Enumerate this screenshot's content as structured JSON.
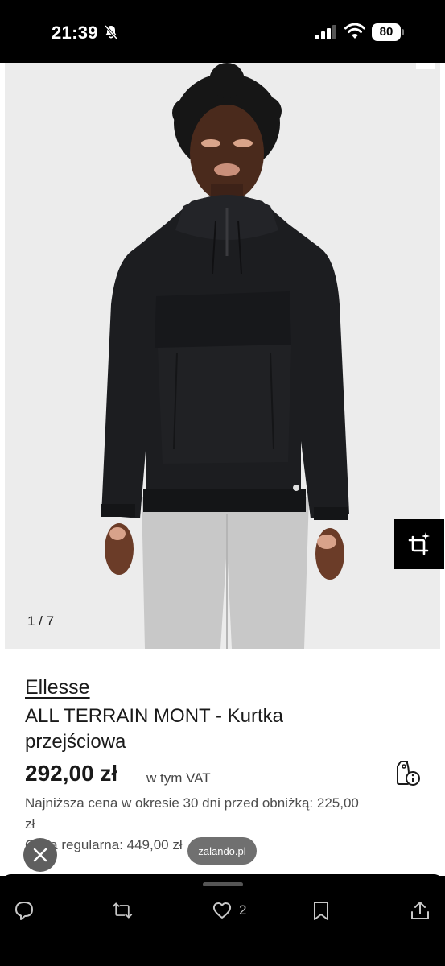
{
  "status_bar": {
    "time": "21:39",
    "battery": "80"
  },
  "gallery": {
    "counter": "1 / 7"
  },
  "product": {
    "brand": "Ellesse",
    "name": "ALL TERRAIN MONT - Kurtka przejściowa",
    "price": "292,00 zł",
    "vat_note": "w tym VAT",
    "lowest_price_note": "Najniższa cena w okresie 30 dni przed obniżką: 225,00 zł",
    "regular_price_note": "Cena regularna: 449,00 zł"
  },
  "overlay": {
    "domain": "zalando.pl"
  },
  "actions": {
    "like_count": "2"
  }
}
